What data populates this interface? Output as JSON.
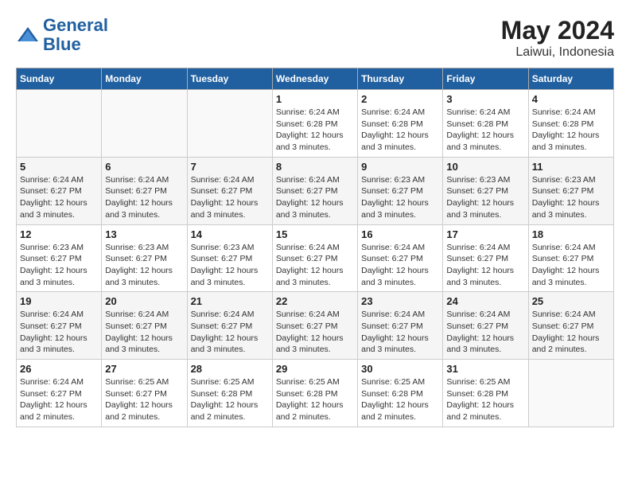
{
  "header": {
    "logo_general": "General",
    "logo_blue": "Blue",
    "month_year": "May 2024",
    "location": "Laiwui, Indonesia"
  },
  "weekdays": [
    "Sunday",
    "Monday",
    "Tuesday",
    "Wednesday",
    "Thursday",
    "Friday",
    "Saturday"
  ],
  "weeks": [
    [
      {
        "day": "",
        "sunrise": "",
        "sunset": "",
        "daylight": ""
      },
      {
        "day": "",
        "sunrise": "",
        "sunset": "",
        "daylight": ""
      },
      {
        "day": "",
        "sunrise": "",
        "sunset": "",
        "daylight": ""
      },
      {
        "day": "1",
        "sunrise": "Sunrise: 6:24 AM",
        "sunset": "Sunset: 6:28 PM",
        "daylight": "Daylight: 12 hours and 3 minutes."
      },
      {
        "day": "2",
        "sunrise": "Sunrise: 6:24 AM",
        "sunset": "Sunset: 6:28 PM",
        "daylight": "Daylight: 12 hours and 3 minutes."
      },
      {
        "day": "3",
        "sunrise": "Sunrise: 6:24 AM",
        "sunset": "Sunset: 6:28 PM",
        "daylight": "Daylight: 12 hours and 3 minutes."
      },
      {
        "day": "4",
        "sunrise": "Sunrise: 6:24 AM",
        "sunset": "Sunset: 6:28 PM",
        "daylight": "Daylight: 12 hours and 3 minutes."
      }
    ],
    [
      {
        "day": "5",
        "sunrise": "Sunrise: 6:24 AM",
        "sunset": "Sunset: 6:27 PM",
        "daylight": "Daylight: 12 hours and 3 minutes."
      },
      {
        "day": "6",
        "sunrise": "Sunrise: 6:24 AM",
        "sunset": "Sunset: 6:27 PM",
        "daylight": "Daylight: 12 hours and 3 minutes."
      },
      {
        "day": "7",
        "sunrise": "Sunrise: 6:24 AM",
        "sunset": "Sunset: 6:27 PM",
        "daylight": "Daylight: 12 hours and 3 minutes."
      },
      {
        "day": "8",
        "sunrise": "Sunrise: 6:24 AM",
        "sunset": "Sunset: 6:27 PM",
        "daylight": "Daylight: 12 hours and 3 minutes."
      },
      {
        "day": "9",
        "sunrise": "Sunrise: 6:23 AM",
        "sunset": "Sunset: 6:27 PM",
        "daylight": "Daylight: 12 hours and 3 minutes."
      },
      {
        "day": "10",
        "sunrise": "Sunrise: 6:23 AM",
        "sunset": "Sunset: 6:27 PM",
        "daylight": "Daylight: 12 hours and 3 minutes."
      },
      {
        "day": "11",
        "sunrise": "Sunrise: 6:23 AM",
        "sunset": "Sunset: 6:27 PM",
        "daylight": "Daylight: 12 hours and 3 minutes."
      }
    ],
    [
      {
        "day": "12",
        "sunrise": "Sunrise: 6:23 AM",
        "sunset": "Sunset: 6:27 PM",
        "daylight": "Daylight: 12 hours and 3 minutes."
      },
      {
        "day": "13",
        "sunrise": "Sunrise: 6:23 AM",
        "sunset": "Sunset: 6:27 PM",
        "daylight": "Daylight: 12 hours and 3 minutes."
      },
      {
        "day": "14",
        "sunrise": "Sunrise: 6:23 AM",
        "sunset": "Sunset: 6:27 PM",
        "daylight": "Daylight: 12 hours and 3 minutes."
      },
      {
        "day": "15",
        "sunrise": "Sunrise: 6:24 AM",
        "sunset": "Sunset: 6:27 PM",
        "daylight": "Daylight: 12 hours and 3 minutes."
      },
      {
        "day": "16",
        "sunrise": "Sunrise: 6:24 AM",
        "sunset": "Sunset: 6:27 PM",
        "daylight": "Daylight: 12 hours and 3 minutes."
      },
      {
        "day": "17",
        "sunrise": "Sunrise: 6:24 AM",
        "sunset": "Sunset: 6:27 PM",
        "daylight": "Daylight: 12 hours and 3 minutes."
      },
      {
        "day": "18",
        "sunrise": "Sunrise: 6:24 AM",
        "sunset": "Sunset: 6:27 PM",
        "daylight": "Daylight: 12 hours and 3 minutes."
      }
    ],
    [
      {
        "day": "19",
        "sunrise": "Sunrise: 6:24 AM",
        "sunset": "Sunset: 6:27 PM",
        "daylight": "Daylight: 12 hours and 3 minutes."
      },
      {
        "day": "20",
        "sunrise": "Sunrise: 6:24 AM",
        "sunset": "Sunset: 6:27 PM",
        "daylight": "Daylight: 12 hours and 3 minutes."
      },
      {
        "day": "21",
        "sunrise": "Sunrise: 6:24 AM",
        "sunset": "Sunset: 6:27 PM",
        "daylight": "Daylight: 12 hours and 3 minutes."
      },
      {
        "day": "22",
        "sunrise": "Sunrise: 6:24 AM",
        "sunset": "Sunset: 6:27 PM",
        "daylight": "Daylight: 12 hours and 3 minutes."
      },
      {
        "day": "23",
        "sunrise": "Sunrise: 6:24 AM",
        "sunset": "Sunset: 6:27 PM",
        "daylight": "Daylight: 12 hours and 3 minutes."
      },
      {
        "day": "24",
        "sunrise": "Sunrise: 6:24 AM",
        "sunset": "Sunset: 6:27 PM",
        "daylight": "Daylight: 12 hours and 3 minutes."
      },
      {
        "day": "25",
        "sunrise": "Sunrise: 6:24 AM",
        "sunset": "Sunset: 6:27 PM",
        "daylight": "Daylight: 12 hours and 2 minutes."
      }
    ],
    [
      {
        "day": "26",
        "sunrise": "Sunrise: 6:24 AM",
        "sunset": "Sunset: 6:27 PM",
        "daylight": "Daylight: 12 hours and 2 minutes."
      },
      {
        "day": "27",
        "sunrise": "Sunrise: 6:25 AM",
        "sunset": "Sunset: 6:27 PM",
        "daylight": "Daylight: 12 hours and 2 minutes."
      },
      {
        "day": "28",
        "sunrise": "Sunrise: 6:25 AM",
        "sunset": "Sunset: 6:28 PM",
        "daylight": "Daylight: 12 hours and 2 minutes."
      },
      {
        "day": "29",
        "sunrise": "Sunrise: 6:25 AM",
        "sunset": "Sunset: 6:28 PM",
        "daylight": "Daylight: 12 hours and 2 minutes."
      },
      {
        "day": "30",
        "sunrise": "Sunrise: 6:25 AM",
        "sunset": "Sunset: 6:28 PM",
        "daylight": "Daylight: 12 hours and 2 minutes."
      },
      {
        "day": "31",
        "sunrise": "Sunrise: 6:25 AM",
        "sunset": "Sunset: 6:28 PM",
        "daylight": "Daylight: 12 hours and 2 minutes."
      },
      {
        "day": "",
        "sunrise": "",
        "sunset": "",
        "daylight": ""
      }
    ]
  ]
}
